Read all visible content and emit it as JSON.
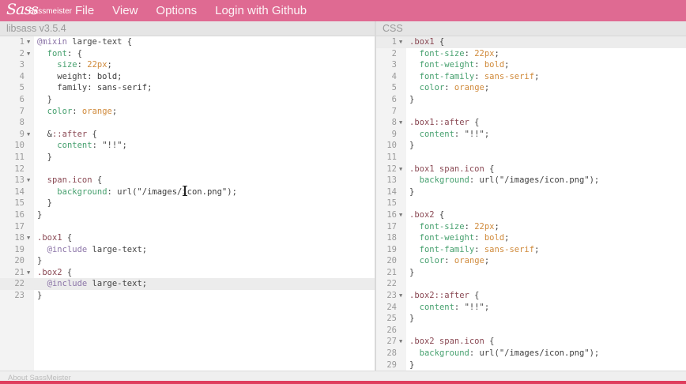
{
  "app": {
    "logo_text": "Sassmeister",
    "menu": [
      "File",
      "View",
      "Options",
      "Login with Github"
    ]
  },
  "panels": {
    "left_title": "libsass v3.5.4",
    "right_title": "CSS"
  },
  "footer": {
    "link": "About SassMeister"
  },
  "colors": {
    "topbar": "#df6a92",
    "selector": "#8b4a55",
    "property": "#46a06e",
    "value": "#d08a3b",
    "at_rule": "#8c75a8",
    "footer_strip": "#df3e5e"
  },
  "scss_editor": {
    "active_line": 22,
    "lines": [
      {
        "n": "1",
        "fold": true,
        "tokens": [
          [
            "at",
            "@mixin"
          ],
          [
            "pun",
            " large-text {"
          ]
        ]
      },
      {
        "n": "2",
        "fold": true,
        "tokens": [
          [
            "pun",
            "  "
          ],
          [
            "prop",
            "font"
          ],
          [
            "pun",
            ": {"
          ]
        ]
      },
      {
        "n": "3",
        "fold": false,
        "tokens": [
          [
            "pun",
            "    "
          ],
          [
            "prop",
            "size"
          ],
          [
            "pun",
            ": "
          ],
          [
            "num",
            "22px"
          ],
          [
            "pun",
            ";"
          ]
        ]
      },
      {
        "n": "4",
        "fold": false,
        "tokens": [
          [
            "pun",
            "    weight: "
          ],
          [
            "str",
            "bold"
          ],
          [
            "pun",
            ";"
          ]
        ]
      },
      {
        "n": "5",
        "fold": false,
        "tokens": [
          [
            "pun",
            "    family: "
          ],
          [
            "str",
            "sans-serif"
          ],
          [
            "pun",
            ";"
          ]
        ]
      },
      {
        "n": "6",
        "fold": false,
        "tokens": [
          [
            "pun",
            "  }"
          ]
        ]
      },
      {
        "n": "7",
        "fold": false,
        "tokens": [
          [
            "pun",
            "  "
          ],
          [
            "prop",
            "color"
          ],
          [
            "pun",
            ": "
          ],
          [
            "val",
            "orange"
          ],
          [
            "pun",
            ";"
          ]
        ]
      },
      {
        "n": "8",
        "fold": false,
        "tokens": []
      },
      {
        "n": "9",
        "fold": true,
        "tokens": [
          [
            "pun",
            "  &"
          ],
          [
            "sel",
            "::after"
          ],
          [
            "pun",
            " {"
          ]
        ]
      },
      {
        "n": "10",
        "fold": false,
        "tokens": [
          [
            "pun",
            "    "
          ],
          [
            "prop",
            "content"
          ],
          [
            "pun",
            ": "
          ],
          [
            "str",
            "\"!!\""
          ],
          [
            "pun",
            ";"
          ]
        ]
      },
      {
        "n": "11",
        "fold": false,
        "tokens": [
          [
            "pun",
            "  }"
          ]
        ]
      },
      {
        "n": "12",
        "fold": false,
        "tokens": []
      },
      {
        "n": "13",
        "fold": true,
        "tokens": [
          [
            "pun",
            "  "
          ],
          [
            "sel",
            "span.icon"
          ],
          [
            "pun",
            " {"
          ]
        ]
      },
      {
        "n": "14",
        "fold": false,
        "tokens": [
          [
            "pun",
            "    "
          ],
          [
            "prop",
            "background"
          ],
          [
            "pun",
            ": url("
          ],
          [
            "str",
            "\"/images/icon.png\""
          ],
          [
            "pun",
            ");"
          ]
        ]
      },
      {
        "n": "15",
        "fold": false,
        "tokens": [
          [
            "pun",
            "  }"
          ]
        ]
      },
      {
        "n": "16",
        "fold": false,
        "tokens": [
          [
            "pun",
            "}"
          ]
        ]
      },
      {
        "n": "17",
        "fold": false,
        "tokens": []
      },
      {
        "n": "18",
        "fold": true,
        "tokens": [
          [
            "sel",
            ".box1"
          ],
          [
            "pun",
            " {"
          ]
        ]
      },
      {
        "n": "19",
        "fold": false,
        "tokens": [
          [
            "pun",
            "  "
          ],
          [
            "at",
            "@include"
          ],
          [
            "pun",
            " large-text;"
          ]
        ]
      },
      {
        "n": "20",
        "fold": false,
        "tokens": [
          [
            "pun",
            "}"
          ]
        ]
      },
      {
        "n": "21",
        "fold": true,
        "tokens": [
          [
            "sel",
            ".box2"
          ],
          [
            "pun",
            " {"
          ]
        ]
      },
      {
        "n": "22",
        "fold": false,
        "tokens": [
          [
            "pun",
            "  "
          ],
          [
            "at",
            "@include"
          ],
          [
            "pun",
            " large-text;"
          ]
        ]
      },
      {
        "n": "23",
        "fold": false,
        "tokens": [
          [
            "pun",
            "}"
          ]
        ]
      }
    ]
  },
  "css_editor": {
    "active_line": 1,
    "lines": [
      {
        "n": "1",
        "fold": true,
        "tokens": [
          [
            "sel",
            ".box1"
          ],
          [
            "pun",
            " {"
          ]
        ]
      },
      {
        "n": "2",
        "fold": false,
        "tokens": [
          [
            "pun",
            "  "
          ],
          [
            "prop",
            "font-size"
          ],
          [
            "pun",
            ": "
          ],
          [
            "num",
            "22px"
          ],
          [
            "pun",
            ";"
          ]
        ]
      },
      {
        "n": "3",
        "fold": false,
        "tokens": [
          [
            "pun",
            "  "
          ],
          [
            "prop",
            "font-weight"
          ],
          [
            "pun",
            ": "
          ],
          [
            "val",
            "bold"
          ],
          [
            "pun",
            ";"
          ]
        ]
      },
      {
        "n": "4",
        "fold": false,
        "tokens": [
          [
            "pun",
            "  "
          ],
          [
            "prop",
            "font-family"
          ],
          [
            "pun",
            ": "
          ],
          [
            "val",
            "sans-serif"
          ],
          [
            "pun",
            ";"
          ]
        ]
      },
      {
        "n": "5",
        "fold": false,
        "tokens": [
          [
            "pun",
            "  "
          ],
          [
            "prop",
            "color"
          ],
          [
            "pun",
            ": "
          ],
          [
            "val",
            "orange"
          ],
          [
            "pun",
            ";"
          ]
        ]
      },
      {
        "n": "6",
        "fold": false,
        "tokens": [
          [
            "pun",
            "}"
          ]
        ]
      },
      {
        "n": "7",
        "fold": false,
        "tokens": []
      },
      {
        "n": "8",
        "fold": true,
        "tokens": [
          [
            "sel",
            ".box1::after"
          ],
          [
            "pun",
            " {"
          ]
        ]
      },
      {
        "n": "9",
        "fold": false,
        "tokens": [
          [
            "pun",
            "  "
          ],
          [
            "prop",
            "content"
          ],
          [
            "pun",
            ": "
          ],
          [
            "str",
            "\"!!\""
          ],
          [
            "pun",
            ";"
          ]
        ]
      },
      {
        "n": "10",
        "fold": false,
        "tokens": [
          [
            "pun",
            "}"
          ]
        ]
      },
      {
        "n": "11",
        "fold": false,
        "tokens": []
      },
      {
        "n": "12",
        "fold": true,
        "tokens": [
          [
            "sel",
            ".box1 span.icon"
          ],
          [
            "pun",
            " {"
          ]
        ]
      },
      {
        "n": "13",
        "fold": false,
        "tokens": [
          [
            "pun",
            "  "
          ],
          [
            "prop",
            "background"
          ],
          [
            "pun",
            ": url("
          ],
          [
            "str",
            "\"/images/icon.png\""
          ],
          [
            "pun",
            ");"
          ]
        ]
      },
      {
        "n": "14",
        "fold": false,
        "tokens": [
          [
            "pun",
            "}"
          ]
        ]
      },
      {
        "n": "15",
        "fold": false,
        "tokens": []
      },
      {
        "n": "16",
        "fold": true,
        "tokens": [
          [
            "sel",
            ".box2"
          ],
          [
            "pun",
            " {"
          ]
        ]
      },
      {
        "n": "17",
        "fold": false,
        "tokens": [
          [
            "pun",
            "  "
          ],
          [
            "prop",
            "font-size"
          ],
          [
            "pun",
            ": "
          ],
          [
            "num",
            "22px"
          ],
          [
            "pun",
            ";"
          ]
        ]
      },
      {
        "n": "18",
        "fold": false,
        "tokens": [
          [
            "pun",
            "  "
          ],
          [
            "prop",
            "font-weight"
          ],
          [
            "pun",
            ": "
          ],
          [
            "val",
            "bold"
          ],
          [
            "pun",
            ";"
          ]
        ]
      },
      {
        "n": "19",
        "fold": false,
        "tokens": [
          [
            "pun",
            "  "
          ],
          [
            "prop",
            "font-family"
          ],
          [
            "pun",
            ": "
          ],
          [
            "val",
            "sans-serif"
          ],
          [
            "pun",
            ";"
          ]
        ]
      },
      {
        "n": "20",
        "fold": false,
        "tokens": [
          [
            "pun",
            "  "
          ],
          [
            "prop",
            "color"
          ],
          [
            "pun",
            ": "
          ],
          [
            "val",
            "orange"
          ],
          [
            "pun",
            ";"
          ]
        ]
      },
      {
        "n": "21",
        "fold": false,
        "tokens": [
          [
            "pun",
            "}"
          ]
        ]
      },
      {
        "n": "22",
        "fold": false,
        "tokens": []
      },
      {
        "n": "23",
        "fold": true,
        "tokens": [
          [
            "sel",
            ".box2::after"
          ],
          [
            "pun",
            " {"
          ]
        ]
      },
      {
        "n": "24",
        "fold": false,
        "tokens": [
          [
            "pun",
            "  "
          ],
          [
            "prop",
            "content"
          ],
          [
            "pun",
            ": "
          ],
          [
            "str",
            "\"!!\""
          ],
          [
            "pun",
            ";"
          ]
        ]
      },
      {
        "n": "25",
        "fold": false,
        "tokens": [
          [
            "pun",
            "}"
          ]
        ]
      },
      {
        "n": "26",
        "fold": false,
        "tokens": []
      },
      {
        "n": "27",
        "fold": true,
        "tokens": [
          [
            "sel",
            ".box2 span.icon"
          ],
          [
            "pun",
            " {"
          ]
        ]
      },
      {
        "n": "28",
        "fold": false,
        "tokens": [
          [
            "pun",
            "  "
          ],
          [
            "prop",
            "background"
          ],
          [
            "pun",
            ": url("
          ],
          [
            "str",
            "\"/images/icon.png\""
          ],
          [
            "pun",
            ");"
          ]
        ]
      },
      {
        "n": "29",
        "fold": false,
        "tokens": [
          [
            "pun",
            "}"
          ]
        ]
      }
    ]
  }
}
